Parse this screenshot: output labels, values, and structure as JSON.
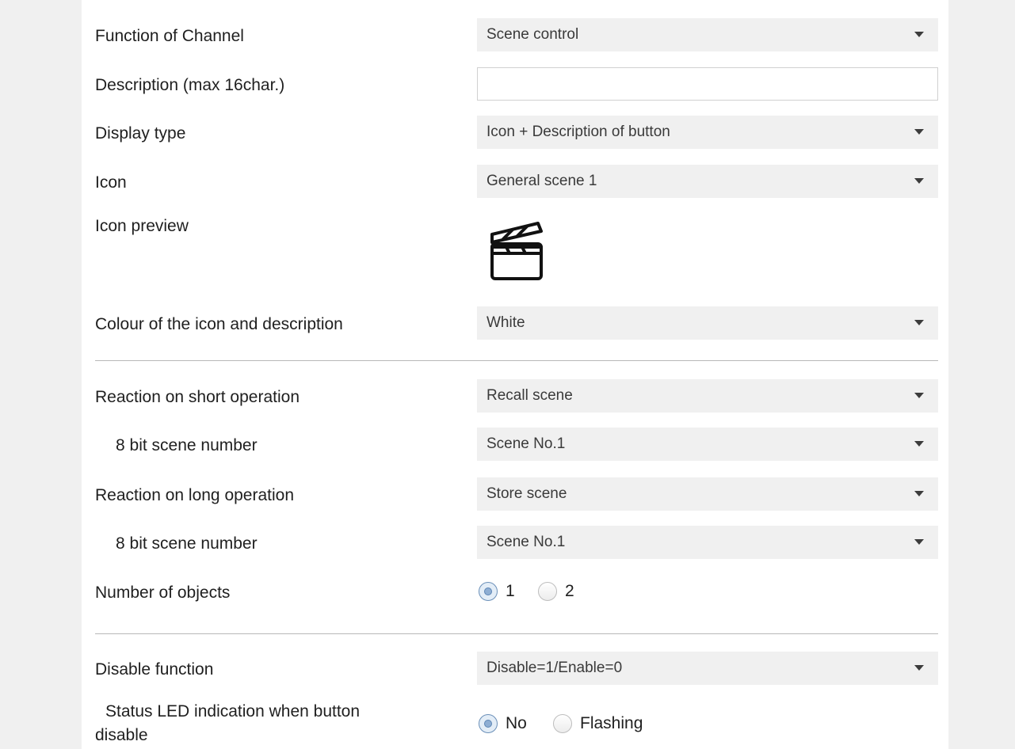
{
  "fields": {
    "function_of_channel": {
      "label": "Function of Channel",
      "value": "Scene control"
    },
    "description": {
      "label": "Description (max 16char.)",
      "value": ""
    },
    "display_type": {
      "label": "Display type",
      "value": "Icon + Description of button"
    },
    "icon": {
      "label": "Icon",
      "value": "General scene 1"
    },
    "icon_preview": {
      "label": "Icon preview",
      "icon": "clapperboard-icon"
    },
    "colour": {
      "label": "Colour of the icon and description",
      "value": "White"
    },
    "short_operation": {
      "label": "Reaction on short operation",
      "value": "Recall scene"
    },
    "short_scene_number": {
      "label": "8 bit scene number",
      "value": "Scene No.1"
    },
    "long_operation": {
      "label": "Reaction on long operation",
      "value": "Store scene"
    },
    "long_scene_number": {
      "label": "8 bit scene number",
      "value": "Scene No.1"
    },
    "number_of_objects": {
      "label": "Number of objects",
      "options": [
        "1",
        "2"
      ],
      "selected": "1"
    },
    "disable_function": {
      "label": "Disable function",
      "value": "Disable=1/Enable=0"
    },
    "status_led": {
      "label_line1": "Status LED indication when button",
      "label_line2": "disable",
      "options": [
        "No",
        "Flashing"
      ],
      "selected": "No"
    }
  }
}
